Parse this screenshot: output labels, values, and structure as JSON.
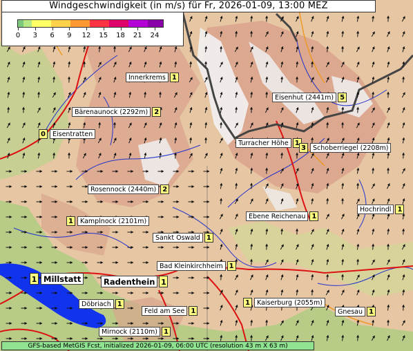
{
  "title": "Windgeschwindigkeit (in m/s) für Fr, 2026-01-09, 13:00 MEZ",
  "legend": {
    "ticks": [
      "0",
      "3",
      "6",
      "9",
      "12",
      "15",
      "18",
      "21",
      "24"
    ],
    "colors": [
      "#7fc97f",
      "#b8e986",
      "#ffff66",
      "#ffd24a",
      "#ff9933",
      "#ff3344",
      "#e0006a",
      "#b400d6",
      "#8a00a8"
    ]
  },
  "footer": "GFS-based MetGIS Fcst, initialized 2026-01-09, 06:00 UTC  (resolution 43 m X 63 m)",
  "locations": [
    {
      "name": "Innerkrems",
      "value": "1"
    },
    {
      "name": "Bärenaunock (2292m)",
      "value": "2"
    },
    {
      "name": "Eisentratten",
      "value": "0"
    },
    {
      "name": "Eisenhut (2441m)",
      "value": "5"
    },
    {
      "name": "Turracher Höhe",
      "value": "1"
    },
    {
      "name": "Schoberriegel (2208m)",
      "value": "3"
    },
    {
      "name": "Rosennock (2440m)",
      "value": "2"
    },
    {
      "name": "Hochrindl",
      "value": "1"
    },
    {
      "name": "Kamplnock (2101m)",
      "value": "1"
    },
    {
      "name": "Ebene Reichenau",
      "value": "1"
    },
    {
      "name": "Sankt Oswald",
      "value": "1"
    },
    {
      "name": "Bad Kleinkirchheim",
      "value": "1"
    },
    {
      "name": "Millstatt",
      "value": "1"
    },
    {
      "name": "Radenthein",
      "value": "1"
    },
    {
      "name": "Döbriach",
      "value": "1"
    },
    {
      "name": "Kaiserburg (2055m)",
      "value": "1"
    },
    {
      "name": "Feld am See",
      "value": "1"
    },
    {
      "name": "Gnesau",
      "value": "1"
    },
    {
      "name": "Mirnock (2110m)",
      "value": "1"
    }
  ]
}
